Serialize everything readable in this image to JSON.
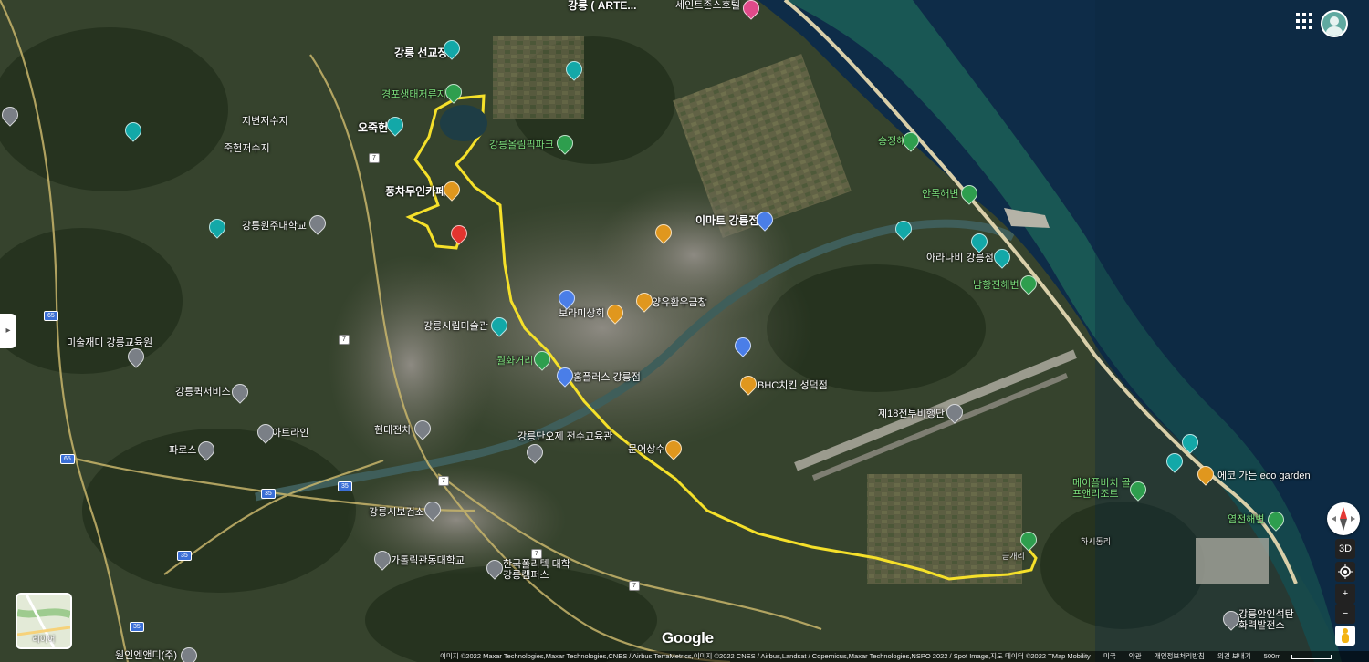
{
  "header": {
    "apps_icon": "apps-grid-icon",
    "avatar_icon": "user-avatar-icon"
  },
  "sidebar": {
    "toggle_glyph": "▸"
  },
  "layers": {
    "label": "레이어"
  },
  "map": {
    "labels": [
      {
        "name": "gangneung-seongyojang",
        "text": "강릉 선교장",
        "cls": "big"
      },
      {
        "name": "gyeongpo-ecology",
        "text": "경포생태저류지",
        "cls": "green"
      },
      {
        "name": "ojukheon",
        "text": "오죽헌",
        "cls": "big"
      },
      {
        "name": "jibyeon-reservoir",
        "text": "지변저수지",
        "cls": ""
      },
      {
        "name": "jukheon-reservoir",
        "text": "죽헌저수지",
        "cls": ""
      },
      {
        "name": "olympic-park",
        "text": "강릉올림픽파크",
        "cls": "green"
      },
      {
        "name": "pungcha-cafe",
        "text": "풍차무인카페",
        "cls": "big"
      },
      {
        "name": "gangneung-wonju-univ",
        "text": "강릉원주대학교",
        "cls": ""
      },
      {
        "name": "emart",
        "text": "이마트 강릉점",
        "cls": "big"
      },
      {
        "name": "arte",
        "text": "강릉 ( ARTE...",
        "cls": "big"
      },
      {
        "name": "sejeong-beach",
        "text": "세인트존스호텔",
        "cls": ""
      },
      {
        "name": "songjeong-beach",
        "text": "송정해변",
        "cls": "green"
      },
      {
        "name": "anmok-beach",
        "text": "안목해변",
        "cls": "green"
      },
      {
        "name": "arahbiche",
        "text": "아라나비 강릉점",
        "cls": ""
      },
      {
        "name": "namhang-beach",
        "text": "남항진해변",
        "cls": "green"
      },
      {
        "name": "gangneung-art-museum",
        "text": "강릉시립미술관",
        "cls": ""
      },
      {
        "name": "boramisanghoe",
        "text": "보라미상회",
        "cls": ""
      },
      {
        "name": "yangyu",
        "text": "양유환우금창",
        "cls": ""
      },
      {
        "name": "wolhwa-street",
        "text": "월화거리",
        "cls": "green"
      },
      {
        "name": "homeplus",
        "text": "홈플러스 강릉점",
        "cls": ""
      },
      {
        "name": "bhc",
        "text": "BHC치킨 성덕점",
        "cls": ""
      },
      {
        "name": "art-school",
        "text": "미술재미 강릉교육원",
        "cls": ""
      },
      {
        "name": "quick-service",
        "text": "강릉퀵서비스",
        "cls": ""
      },
      {
        "name": "atrine",
        "text": "아트라인",
        "cls": ""
      },
      {
        "name": "paros",
        "text": "파로스",
        "cls": ""
      },
      {
        "name": "hyundai",
        "text": "현대전차",
        "cls": ""
      },
      {
        "name": "dano-center",
        "text": "강릉단오제 전수교육관",
        "cls": ""
      },
      {
        "name": "munsansang",
        "text": "문어상수",
        "cls": ""
      },
      {
        "name": "air-wing",
        "text": "제18전투비행단",
        "cls": ""
      },
      {
        "name": "ecogarden",
        "text": "에코 가든 eco garden",
        "cls": ""
      },
      {
        "name": "maple-beach",
        "text": "메이플비치 골프앤리조트",
        "cls": "green"
      },
      {
        "name": "yeomjeon-beach",
        "text": "염전해변",
        "cls": "green"
      },
      {
        "name": "health-center",
        "text": "강릉시보건소",
        "cls": ""
      },
      {
        "name": "catholic-univ",
        "text": "가톨릭관동대학교",
        "cls": ""
      },
      {
        "name": "polytech",
        "text": "한국폴리텍 대학 강릉캠퍼스",
        "cls": ""
      },
      {
        "name": "anin-power",
        "text": "강릉안인석탄 화력발전소",
        "cls": ""
      },
      {
        "name": "wonin-nd",
        "text": "원인엔앤디(주)",
        "cls": ""
      },
      {
        "name": "geumgwang",
        "text": "금개리",
        "cls": ""
      },
      {
        "name": "haesi",
        "text": "하시동리",
        "cls": ""
      }
    ]
  },
  "controls": {
    "compass_icon": "compass-icon",
    "tilt_label": "3D",
    "locate_icon": "my-location-icon",
    "zoom_in": "+",
    "zoom_out": "−",
    "pegman_icon": "pegman-icon"
  },
  "footer": {
    "logo": "Google",
    "attribution": "이미지 ©2022 Maxar Technologies,Maxar Technologies,CNES / Airbus,TerraMetrics,이미지 ©2022 CNES / Airbus,Landsat / Copernicus,Maxar Technologies,NSPO 2022 / Spot Image,지도 데이터 ©2022 TMap Mobility",
    "country": "미국",
    "terms": "약관",
    "privacy": "개인정보처리방침",
    "feedback": "의견 보내기",
    "scale": "500m"
  },
  "colors": {
    "route": "#f5e02a",
    "sea_dark": "#0d2a45",
    "sea_shallow": "#1f6e5e",
    "land": "#3d4a33"
  }
}
